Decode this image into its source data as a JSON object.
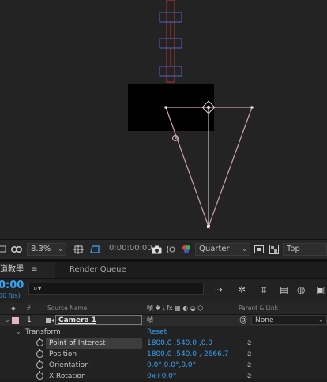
{
  "viewer": {
    "zoom": "8.3%",
    "timecode": "0:00:00:00",
    "resolution": "Quarter",
    "view": "Top"
  },
  "tabs": {
    "comp_tab": "道教學",
    "menu_icon": "≡",
    "render_queue": "Render Queue"
  },
  "timeline": {
    "current_time": "0:00",
    "fps": "00 fps)",
    "search_icon": "search-icon"
  },
  "columns": {
    "number": "#",
    "source_name": "Source Name",
    "switches": "幀 ✱ \\ fx ▦ ◐ ◒ ⬡",
    "parent_link": "Parent & Link"
  },
  "layer": {
    "index": "1",
    "name": "Camera 1",
    "switch_glyph": "幀",
    "parent": "None",
    "label_color": "#e8b4c4"
  },
  "properties": {
    "transform": "Transform",
    "reset": "Reset",
    "point_of_interest": {
      "label": "Point of Interest",
      "value": "1800.0 ,540.0 ,0.0"
    },
    "position": {
      "label": "Position",
      "value": "1800.0 ,540.0 ,-2666.7"
    },
    "orientation": {
      "label": "Orientation",
      "value": "0.0°,0.0°,0.0°"
    },
    "x_rotation": {
      "label": "X Rotation",
      "value": "0x+0.0°"
    }
  },
  "colors": {
    "accent_blue": "#37a5f5",
    "camera_line": "#c9a3b3",
    "layer_red": "#c2323a"
  }
}
